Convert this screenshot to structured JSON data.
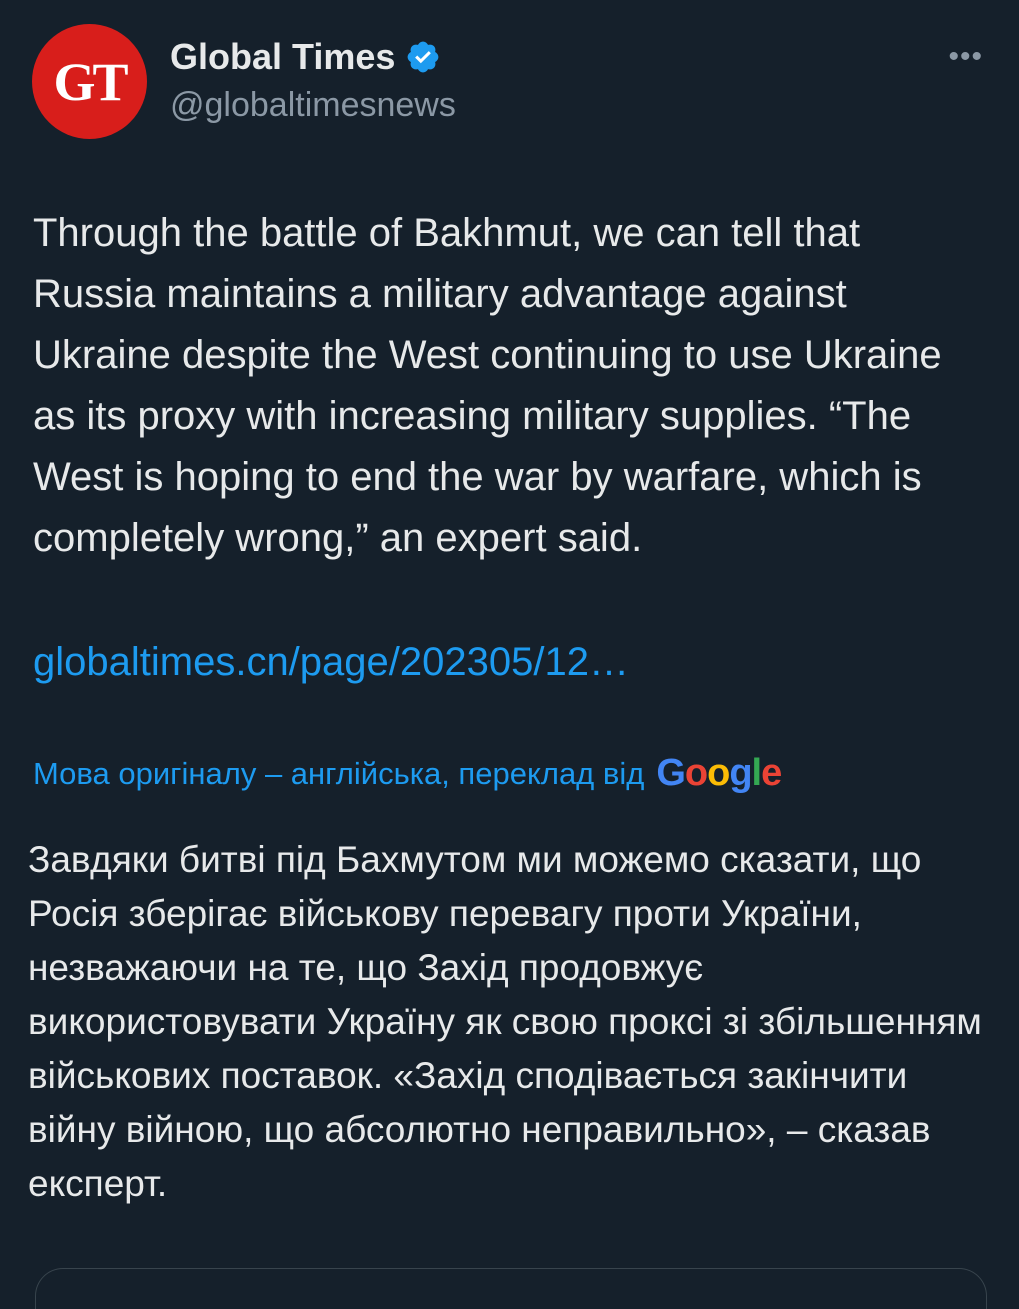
{
  "account": {
    "display_name": "Global Times",
    "handle": "@globaltimesnews",
    "avatar_text": "GT",
    "avatar_color": "#d81e1b",
    "verified": true,
    "verified_color": "#1d9bf0"
  },
  "more_icon": "more-horizontal-icon",
  "more_glyph": "•••",
  "tweet": {
    "text": "Through the battle of Bakhmut, we can tell that Russia maintains a military advantage against Ukraine despite the West continuing to use Ukraine as its proxy with increasing military supplies. “The West is hoping to end the war by warfare, which is completely wrong,” an expert said.",
    "link": "globaltimes.cn/page/202305/12…"
  },
  "translation": {
    "note": "Мова оригіналу – англійська, переклад від",
    "provider": "Google",
    "text": "Завдяки битві під Бахмутом ми можемо сказати, що Росія зберігає військову перевагу проти України, незважаючи на те, що Захід продовжує використовувати Україну як свою проксі зі збільшенням військових поставок. «Захід сподівається закінчити війну війною, що абсолютно неправильно», – сказав експерт."
  },
  "colors": {
    "background": "#15202b",
    "text": "#e7e9ea",
    "secondary": "#8b98a5",
    "link": "#1d9bf0"
  }
}
